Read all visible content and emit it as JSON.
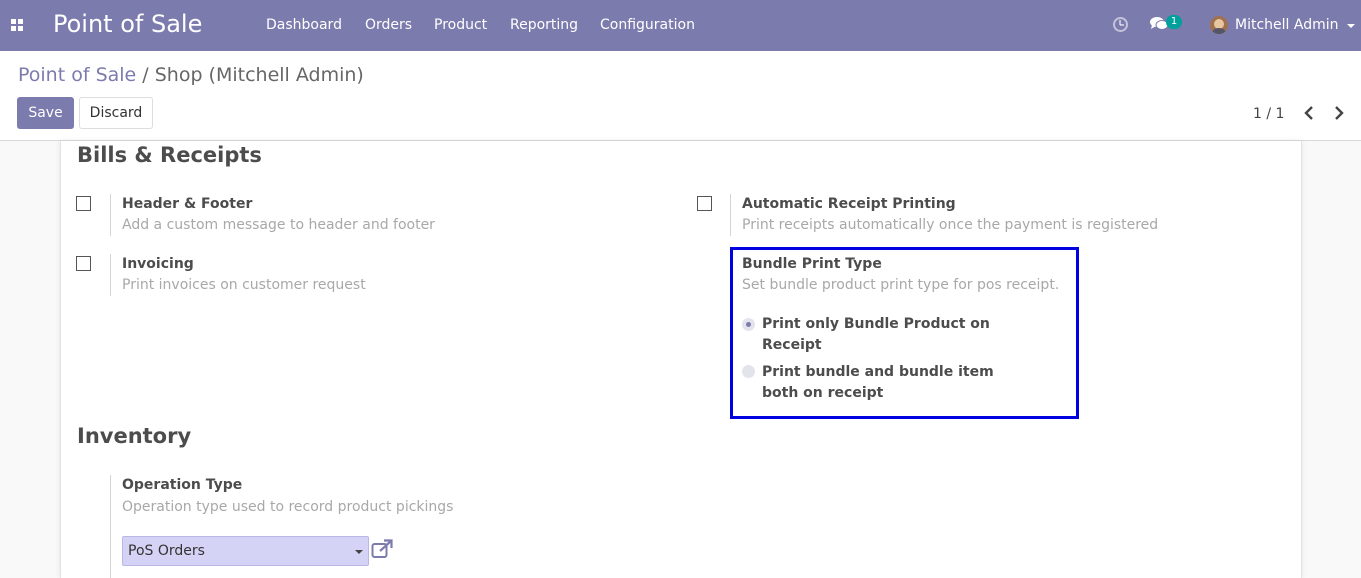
{
  "navbar": {
    "brand": "Point of Sale",
    "menu": [
      "Dashboard",
      "Orders",
      "Product",
      "Reporting",
      "Configuration"
    ],
    "chat_count": "1",
    "user": "Mitchell Admin"
  },
  "breadcrumb": {
    "parent": "Point of Sale",
    "separator": " / ",
    "current": "Shop (Mitchell Admin)"
  },
  "buttons": {
    "save": "Save",
    "discard": "Discard"
  },
  "pager": "1 / 1",
  "bills": {
    "title": "Bills & Receipts",
    "header_footer": {
      "label": "Header & Footer",
      "help": "Add a custom message to header and footer",
      "checked": false
    },
    "auto_print": {
      "label": "Automatic Receipt Printing",
      "help": "Print receipts automatically once the payment is registered",
      "checked": false
    },
    "invoicing": {
      "label": "Invoicing",
      "help": "Print invoices on customer request",
      "checked": false
    },
    "bundle": {
      "label": "Bundle Print Type",
      "help": "Set bundle product print type for pos receipt.",
      "options": [
        {
          "line1": "Print only Bundle Product on",
          "line2": "Receipt",
          "selected": true
        },
        {
          "line1": "Print bundle and bundle item",
          "line2": "both on receipt",
          "selected": false
        }
      ]
    }
  },
  "inventory": {
    "title": "Inventory",
    "operation_type": {
      "label": "Operation Type",
      "help": "Operation type used to record product pickings",
      "value": "PoS Orders"
    }
  },
  "colors": {
    "brand": "#7c7bad",
    "highlight": "#0000e0",
    "badge": "#00a09d"
  }
}
